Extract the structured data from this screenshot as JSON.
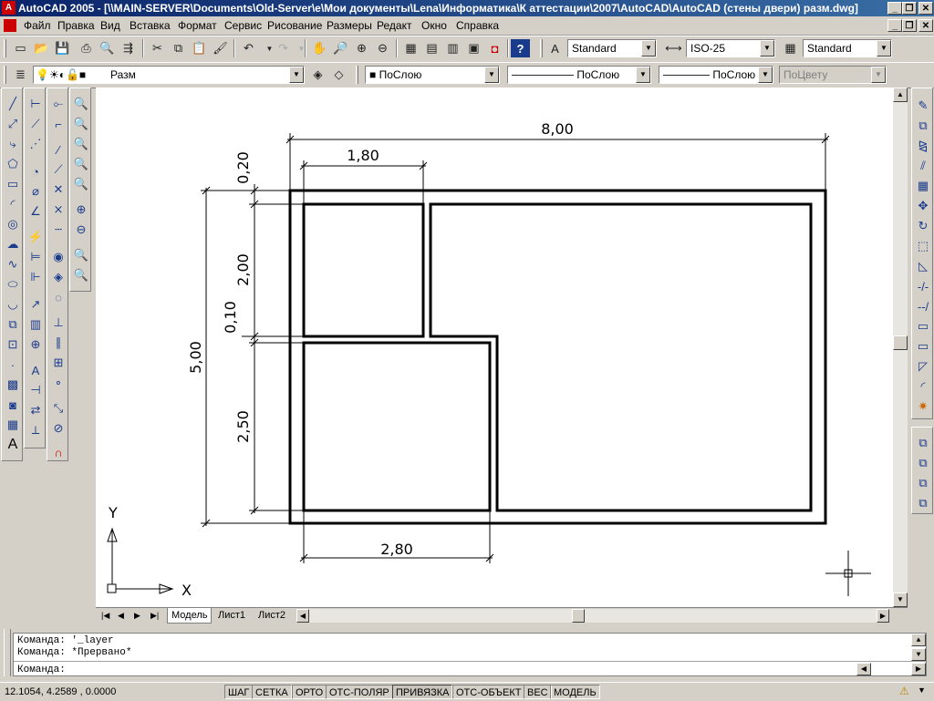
{
  "window": {
    "title": "AutoCAD 2005 - [\\\\MAIN-SERVER\\Documents\\Old-Server\\e\\Мои документы\\Lena\\Информатика\\К аттестации\\2007\\AutoCAD\\AutoCAD (стены двери) разм.dwg]",
    "app_icon_letter": "A"
  },
  "menu": [
    "Файл",
    "Правка",
    "Вид",
    "Вставка",
    "Формат",
    "Сервис",
    "Рисование",
    "Размеры",
    "Редакт",
    "Окно",
    "Справка"
  ],
  "toolbar": {
    "text_style": "Standard",
    "dim_style": "ISO-25",
    "table_style": "Standard",
    "layer": "Разм",
    "color": "ПоСлою",
    "linetype": "ПоСлою",
    "lineweight": "ПоСлою",
    "plotstyle": "ПоЦвету"
  },
  "drawing": {
    "dims": {
      "overall_width": "8,00",
      "room_width": "1,80",
      "lower_width": "2,80",
      "wall_top": "0,20",
      "upper_height": "2,00",
      "partition": "0,10",
      "lower_height": "2,50",
      "overall_height": "5,00"
    },
    "ucs_x": "X",
    "ucs_y": "Y"
  },
  "tabs": [
    "Модель",
    "Лист1",
    "Лист2"
  ],
  "command": {
    "line1": "Команда: '_layer",
    "line2": "Команда: *Прервано*",
    "prompt": "Команда:"
  },
  "status": {
    "coords": "12.1054, 4.2589 , 0.0000",
    "toggles": [
      "ШАГ",
      "СЕТКА",
      "ОРТО",
      "ОТС-ПОЛЯР",
      "ПРИВЯЗКА",
      "ОТС-ОБЪЕКТ",
      "ВЕС",
      "МОДЕЛЬ"
    ]
  }
}
